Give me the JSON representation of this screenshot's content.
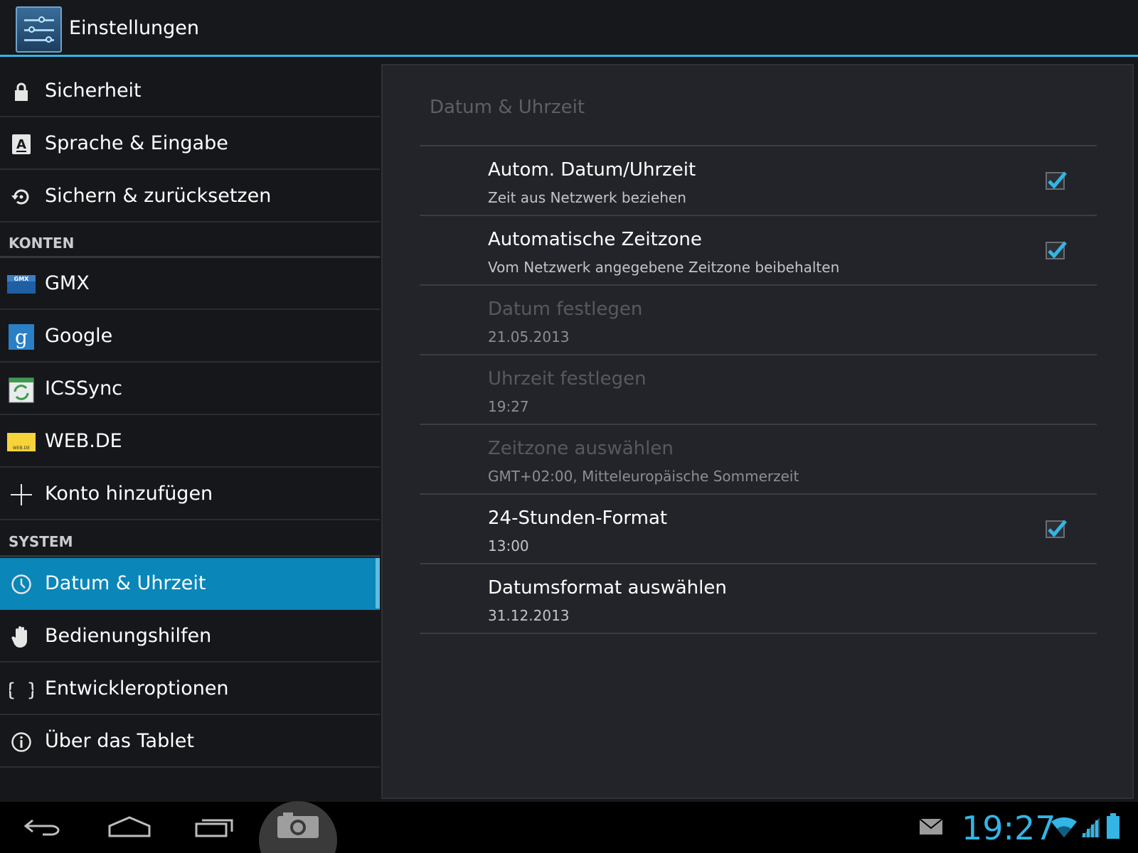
{
  "actionbar": {
    "title": "Einstellungen",
    "icon": "settings-sliders-icon"
  },
  "sidebar": {
    "items_top": [
      {
        "label": "Sicherheit",
        "icon": "lock-icon"
      },
      {
        "label": "Sprache & Eingabe",
        "icon": "keyboard-a-icon"
      },
      {
        "label": "Sichern & zurücksetzen",
        "icon": "backup-restore-icon"
      }
    ],
    "section_accounts": "KONTEN",
    "accounts": [
      {
        "label": "GMX",
        "icon": "gmx-icon"
      },
      {
        "label": "Google",
        "icon": "google-icon"
      },
      {
        "label": "ICSSync",
        "icon": "icssync-icon"
      },
      {
        "label": "WEB.DE",
        "icon": "webde-icon"
      },
      {
        "label": "Konto hinzufügen",
        "icon": "plus-icon"
      }
    ],
    "section_system": "SYSTEM",
    "system": [
      {
        "label": "Datum & Uhrzeit",
        "icon": "clock-icon",
        "selected": true
      },
      {
        "label": "Bedienungshilfen",
        "icon": "hand-icon"
      },
      {
        "label": "Entwickleroptionen",
        "icon": "braces-icon"
      },
      {
        "label": "Über das Tablet",
        "icon": "info-icon"
      }
    ]
  },
  "detail": {
    "title": "Datum & Uhrzeit",
    "prefs": [
      {
        "title": "Autom. Datum/Uhrzeit",
        "summary": "Zeit aus Netzwerk beziehen",
        "checked": true,
        "enabled": true
      },
      {
        "title": "Automatische Zeitzone",
        "summary": "Vom Netzwerk angegebene Zeitzone beibehalten",
        "checked": true,
        "enabled": true
      },
      {
        "title": "Datum festlegen",
        "summary": "21.05.2013",
        "enabled": false
      },
      {
        "title": "Uhrzeit festlegen",
        "summary": "19:27",
        "enabled": false
      },
      {
        "title": "Zeitzone auswählen",
        "summary": "GMT+02:00, Mitteleuropäische Sommerzeit",
        "enabled": false
      },
      {
        "title": "24-Stunden-Format",
        "summary": "13:00",
        "checked": true,
        "enabled": true
      },
      {
        "title": "Datumsformat auswählen",
        "summary": "31.12.2013",
        "enabled": true
      }
    ]
  },
  "navbar": {
    "buttons": [
      "back-icon",
      "home-icon",
      "recent-apps-icon",
      "camera-icon"
    ],
    "status": {
      "time": "19:27",
      "icons": [
        "mail-icon",
        "wifi-icon",
        "signal-icon",
        "battery-icon"
      ]
    }
  },
  "colors": {
    "accent": "#33b5e5",
    "selected": "#0a86b8",
    "panel": "#22242a",
    "background": "#15171b"
  }
}
